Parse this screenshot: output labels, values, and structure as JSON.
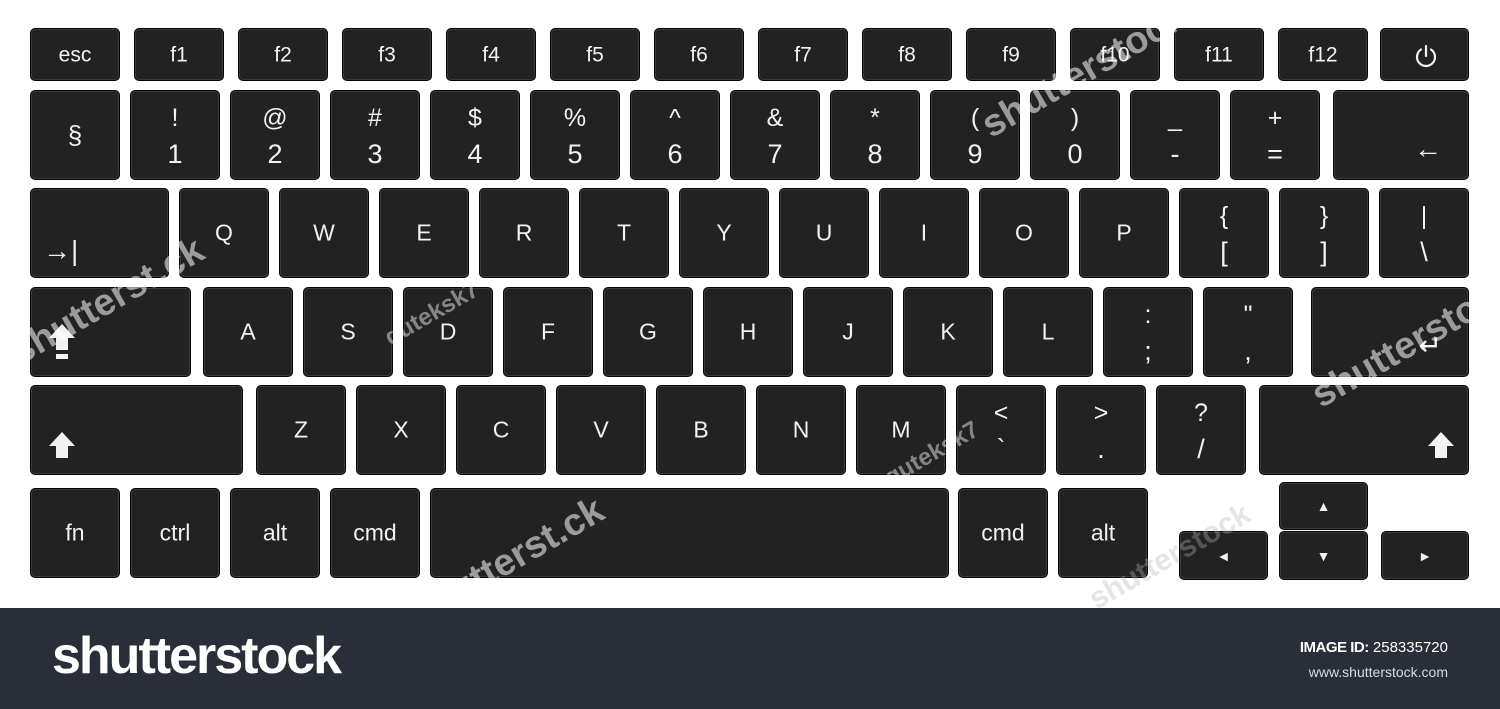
{
  "keyboard": {
    "fn_row": [
      "esc",
      "f1",
      "f2",
      "f3",
      "f4",
      "f5",
      "f6",
      "f7",
      "f8",
      "f9",
      "f10",
      "f11",
      "f12"
    ],
    "number_row": [
      {
        "top": "§",
        "bottom": ""
      },
      {
        "top": "!",
        "bottom": "1"
      },
      {
        "top": "@",
        "bottom": "2"
      },
      {
        "top": "#",
        "bottom": "3"
      },
      {
        "top": "$",
        "bottom": "4"
      },
      {
        "top": "%",
        "bottom": "5"
      },
      {
        "top": "^",
        "bottom": "6"
      },
      {
        "top": "&",
        "bottom": "7"
      },
      {
        "top": "*",
        "bottom": "8"
      },
      {
        "top": "(",
        "bottom": "9"
      },
      {
        "top": ")",
        "bottom": "0"
      },
      {
        "top": "_",
        "bottom": "-"
      },
      {
        "top": "+",
        "bottom": "="
      }
    ],
    "backspace_glyph": "←",
    "tab_glyph": "→|",
    "top_row": [
      "Q",
      "W",
      "E",
      "R",
      "T",
      "Y",
      "U",
      "I",
      "O",
      "P"
    ],
    "top_row_symbols": [
      {
        "top": "{",
        "bottom": "["
      },
      {
        "top": "}",
        "bottom": "]"
      },
      {
        "top": "|",
        "bottom": "\\"
      }
    ],
    "home_row": [
      "A",
      "S",
      "D",
      "F",
      "G",
      "H",
      "J",
      "K",
      "L"
    ],
    "home_row_symbols": [
      {
        "top": ":",
        "bottom": ";"
      },
      {
        "top": "\"",
        "bottom": ","
      }
    ],
    "return_glyph": "↵",
    "bottom_row": [
      "Z",
      "X",
      "C",
      "V",
      "B",
      "N",
      "M"
    ],
    "bottom_row_symbols": [
      {
        "top": "<",
        "bottom": "`"
      },
      {
        "top": ">",
        "bottom": "."
      },
      {
        "top": "?",
        "bottom": "/"
      }
    ],
    "modifiers_left": [
      "fn",
      "ctrl",
      "alt",
      "cmd"
    ],
    "modifiers_right": [
      "cmd",
      "alt"
    ],
    "arrows": {
      "up": "▲",
      "down": "▼",
      "left": "◄",
      "right": "►"
    }
  },
  "footer": {
    "brand": "shutterstock",
    "image_id_label": "IMAGE ID:",
    "image_id": "258335720",
    "url": "www.shutterstock.com"
  },
  "watermarks": [
    "shutterstock",
    "guteksk7",
    "shutterstock",
    "guteksk7",
    "shutterst.ck",
    "shutterst.ck",
    "shutterstock"
  ],
  "colors": {
    "key": "#222222",
    "key_border": "#050505",
    "key_text": "#f2f2f2",
    "footer": "#2a2e38",
    "background": "#ffffff"
  },
  "icons": {
    "power": "power-icon",
    "caps_lock": "caps-lock-icon",
    "shift": "shift-arrow-icon"
  }
}
